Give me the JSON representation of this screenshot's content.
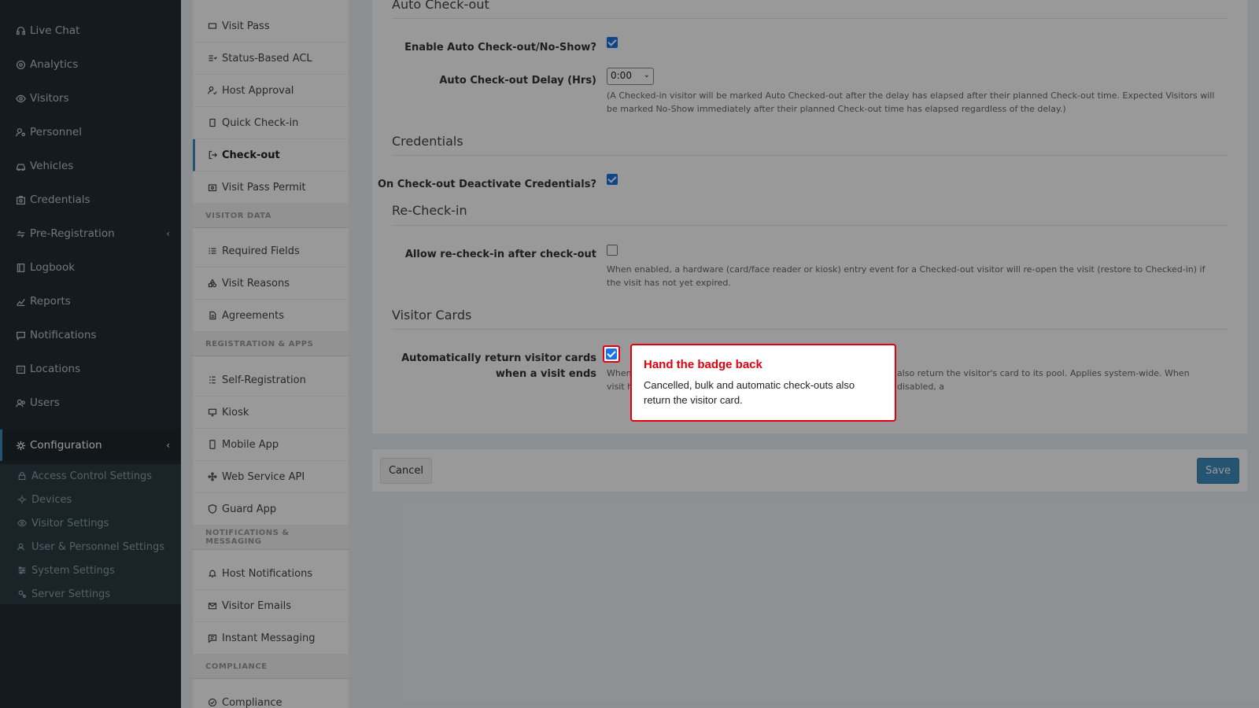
{
  "sidebar": {
    "items": [
      {
        "label": "Live Chat",
        "icon": "headset-icon"
      },
      {
        "label": "Analytics",
        "icon": "target-icon"
      },
      {
        "label": "Visitors",
        "icon": "eye-icon"
      },
      {
        "label": "Personnel",
        "icon": "user-cog-icon"
      },
      {
        "label": "Vehicles",
        "icon": "car-icon"
      },
      {
        "label": "Credentials",
        "icon": "id-card-icon"
      },
      {
        "label": "Pre-Registration",
        "icon": "arrows-icon"
      },
      {
        "label": "Logbook",
        "icon": "book-icon"
      },
      {
        "label": "Reports",
        "icon": "chart-icon"
      },
      {
        "label": "Notifications",
        "icon": "chat-icon"
      },
      {
        "label": "Locations",
        "icon": "building-icon"
      },
      {
        "label": "Users",
        "icon": "users-icon"
      },
      {
        "label": "Configuration",
        "icon": "gear-icon"
      }
    ],
    "submenu": [
      {
        "label": "Access Control Settings",
        "icon": "lock-icon"
      },
      {
        "label": "Devices",
        "icon": "gear-icon"
      },
      {
        "label": "Visitor Settings",
        "icon": "eye-icon"
      },
      {
        "label": "User & Personnel Settings",
        "icon": "users-icon"
      },
      {
        "label": "System Settings",
        "icon": "sliders-icon"
      },
      {
        "label": "Server Settings",
        "icon": "server-icon"
      }
    ]
  },
  "subnav": {
    "items": [
      {
        "label": "Visit Pass"
      },
      {
        "label": "Status-Based ACL"
      },
      {
        "label": "Host Approval"
      },
      {
        "label": "Quick Check-in"
      },
      {
        "label": "Check-out"
      },
      {
        "label": "Visit Pass Permit"
      },
      {
        "label": "Required Fields"
      },
      {
        "label": "Visit Reasons"
      },
      {
        "label": "Agreements"
      },
      {
        "label": "Self-Registration"
      },
      {
        "label": "Kiosk"
      },
      {
        "label": "Mobile App"
      },
      {
        "label": "Web Service API"
      },
      {
        "label": "Guard App"
      },
      {
        "label": "Host Notifications"
      },
      {
        "label": "Visitor Emails"
      },
      {
        "label": "Instant Messaging"
      },
      {
        "label": "Compliance"
      }
    ],
    "headers": [
      "VISITOR DATA",
      "REGISTRATION & APPS",
      "NOTIFICATIONS & MESSAGING",
      "COMPLIANCE"
    ]
  },
  "content": {
    "auto_checkout": {
      "title": "Auto Check-out",
      "enable_label": "Enable Auto Check-out/No-Show?",
      "enable_checked": true,
      "delay_label": "Auto Check-out Delay (Hrs)",
      "delay_value": "0:00",
      "delay_help": "(A Checked-in visitor will be marked Auto Checked-out after the delay has elapsed after their planned Check-out time. Expected Visitors will be marked No-Show immediately after their planned Check-out time has elapsed regardless of the delay.)"
    },
    "credentials": {
      "title": "Credentials",
      "deactivate_label": "On Check-out Deactivate Credentials?",
      "deactivate_checked": true
    },
    "recheckin": {
      "title": "Re-Check-in",
      "allow_label": "Allow re-check-in after check-out",
      "allow_checked": false,
      "allow_help": "When enabled, a hardware (card/face reader or kiosk) entry event for a Checked-out visitor will re-open the visit (restore to Checked-in) if the visit has not yet expired."
    },
    "visitor_cards": {
      "title": "Visitor Cards",
      "return_label_1": "Automatically return visitor cards",
      "return_label_2": "when a visit ends",
      "return_checked": true,
      "help_left_1": "When",
      "help_left_2": "visit h",
      "help_right": "also return the visitor's card to its pool. Applies system-wide. When disabled, a"
    }
  },
  "footer": {
    "cancel_label": "Cancel",
    "save_label": "Save"
  },
  "tooltip": {
    "title": "Hand the badge back",
    "body": "Cancelled, bulk and automatic check-outs also return the visitor card."
  },
  "colors": {
    "sidebar_bg": "#222d32",
    "accent": "#3c8dbc",
    "checkbox": "#1a73e8",
    "highlight": "#e3000f"
  }
}
